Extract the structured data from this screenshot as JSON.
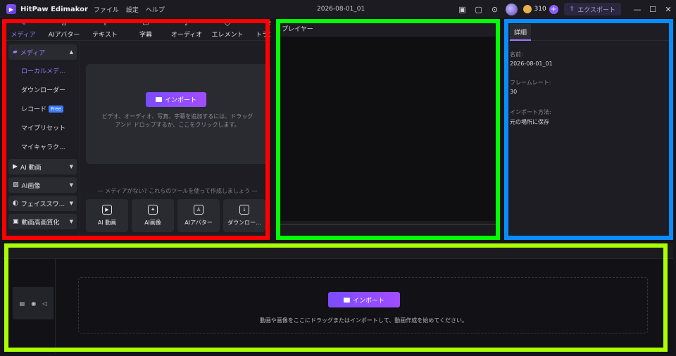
{
  "titlebar": {
    "app_name": "HitPaw Edimakor",
    "menu": [
      "ファイル",
      "設定",
      "ヘルプ"
    ],
    "document_title": "2026-08-01_01",
    "credits": "310",
    "export_label": "エクスポート"
  },
  "media_tabs": [
    {
      "label": "メディア",
      "icon": "media-icon"
    },
    {
      "label": "AIアバター",
      "icon": "avatar-icon"
    },
    {
      "label": "テキスト",
      "icon": "text-icon"
    },
    {
      "label": "字幕",
      "icon": "subtitle-icon"
    },
    {
      "label": "オーディオ",
      "icon": "audio-icon"
    },
    {
      "label": "エレメント",
      "icon": "element-icon"
    },
    {
      "label": "トランジ",
      "icon": "transition-icon"
    }
  ],
  "sidebar": {
    "media_group": "メディア",
    "media_items": [
      "ローカルメデ...",
      "ダウンローダー",
      "レコード",
      "マイプリセット",
      "マイキャラク..."
    ],
    "free_badge": "Free",
    "groups": [
      "AI 動画",
      "AI画像",
      "フェイススワ...",
      "動画高画質化"
    ]
  },
  "media_panel": {
    "import_label": "インポート",
    "drop_hint": "ビデオ、オーディオ、写真、字幕を追加するには、ドラッグ アンド ドロップするか、ここをクリックします。",
    "tools_hint": "— メディアがない? これらのツールを使って作成しましょう —",
    "tools": [
      "AI 動画",
      "AI画像",
      "AIアバター",
      "ダウンロー..."
    ]
  },
  "player": {
    "title": "プレイヤー"
  },
  "details": {
    "tab_label": "詳細",
    "name_label": "名前:",
    "name_value": "2026-08-01_01",
    "framerate_label": "フレームレート:",
    "framerate_value": "30",
    "import_method_label": "インポート方法:",
    "import_method_value": "元の場所に保存"
  },
  "timeline": {
    "import_label": "インポート",
    "hint": "動画や画像をここにドラッグまたはインポートして、動画作成を始めてください。"
  },
  "colors": {
    "accent": "#9d7bff",
    "annotation_red": "#ff0000",
    "annotation_green": "#00ff00",
    "annotation_blue": "#0a8cff",
    "annotation_lime": "#aaff00"
  }
}
